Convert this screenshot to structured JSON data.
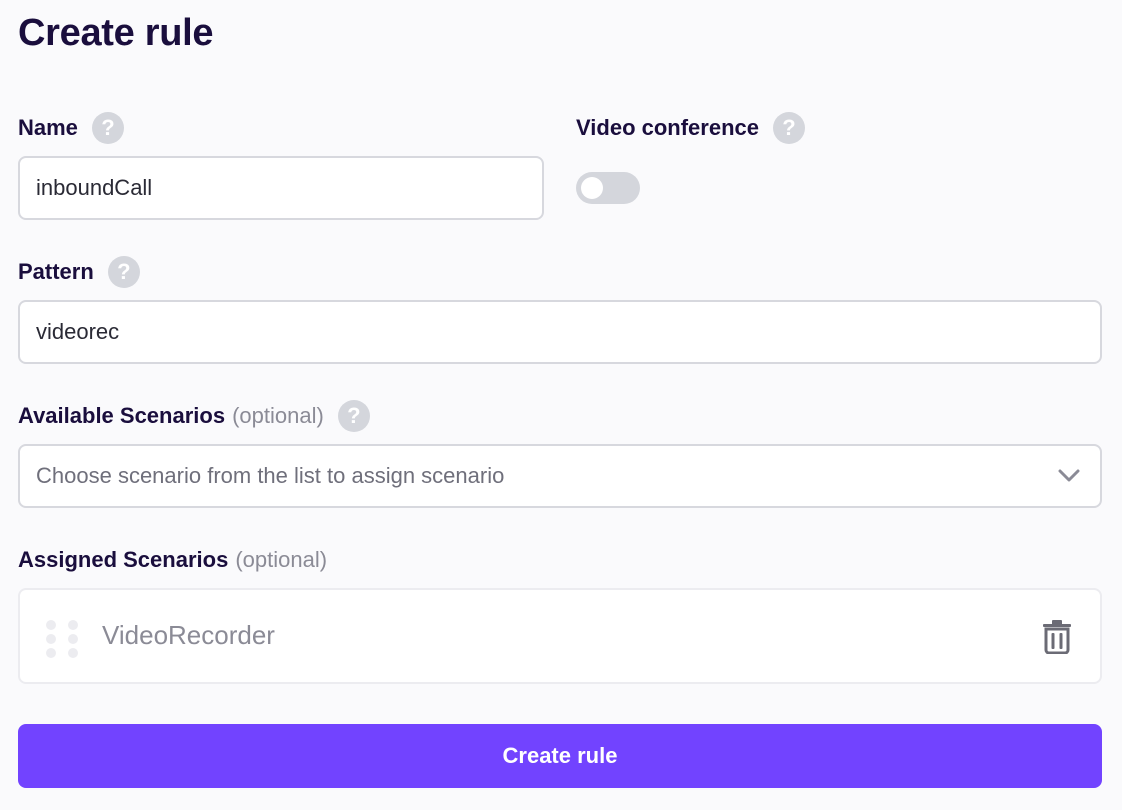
{
  "page": {
    "title": "Create rule"
  },
  "name_field": {
    "label": "Name",
    "value": "inboundCall",
    "help": "?"
  },
  "video_conference": {
    "label": "Video conference",
    "enabled": false,
    "help": "?"
  },
  "pattern_field": {
    "label": "Pattern",
    "value": "videorec",
    "help": "?"
  },
  "available_scenarios": {
    "label": "Available Scenarios",
    "optional": "(optional)",
    "placeholder": "Choose scenario from the list to assign scenario",
    "help": "?"
  },
  "assigned_scenarios": {
    "label": "Assigned Scenarios",
    "optional": "(optional)",
    "items": [
      {
        "name": "VideoRecorder"
      }
    ]
  },
  "submit": {
    "label": "Create rule"
  },
  "colors": {
    "accent": "#7243ff",
    "heading": "#1a0e3d",
    "muted": "#8b8b96",
    "border": "#d7d8de"
  },
  "icons": [
    "help-icon",
    "chevron-down-icon",
    "drag-handle-icon",
    "trash-icon"
  ]
}
